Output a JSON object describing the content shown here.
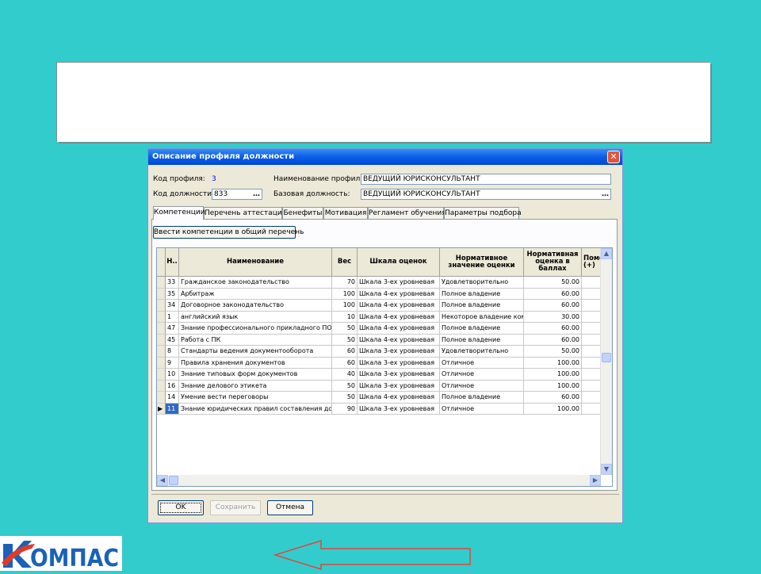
{
  "dialog": {
    "title": "Описание профиля должности",
    "close_glyph": "✕",
    "profile_code_label": "Код профиля:",
    "profile_code_value": "3",
    "profile_name_label": "Наименование профиля:",
    "profile_name_value": "ВЕДУЩИЙ ЮРИСКОНСУЛЬТАНТ",
    "position_code_label": "Код должности:",
    "position_code_value": "833",
    "base_position_label": "Базовая должность:",
    "base_position_value": "ВЕДУЩИЙ ЮРИСКОНСУЛЬТАНТ",
    "ellipsis": "…",
    "tabs": [
      {
        "label": "Компетенции",
        "active": true
      },
      {
        "label": "Перечень аттестаций",
        "active": false
      },
      {
        "label": "Бенефиты",
        "active": false
      },
      {
        "label": "Мотивация",
        "active": false
      },
      {
        "label": "Регламент обучения",
        "active": false
      },
      {
        "label": "Параметры подбора",
        "active": false
      }
    ],
    "add_competencies_button": "Ввести компетенции в общий перечень",
    "grid": {
      "columns": [
        "Н..",
        "Наименование",
        "Вес",
        "Шкала оценок",
        "Нормативное значение оценки",
        "Нормативная оценка в баллах",
        "Поме. (+)"
      ],
      "rows": [
        [
          "33",
          "Гражданское законодательство",
          "70",
          "Шкала 3-ех уровневая",
          "Удовлетворительно",
          "50.00"
        ],
        [
          "35",
          "Арбитраж",
          "100",
          "Шкала 4-ех уровневая",
          "Полное владение",
          "60.00"
        ],
        [
          "34",
          "Договорное законодательство",
          "100",
          "Шкала 4-ех уровневая",
          "Полное владение",
          "60.00"
        ],
        [
          "1",
          "английский язык",
          "10",
          "Шкала 4-ех уровневая",
          "Некоторое владение ком",
          "30.00"
        ],
        [
          "47",
          "Знание профессионального прикладного ПО",
          "50",
          "Шкала 4-ех уровневая",
          "Полное владение",
          "60.00"
        ],
        [
          "45",
          "Работа с ПК",
          "50",
          "Шкала 4-ех уровневая",
          "Полное владение",
          "60.00"
        ],
        [
          "8",
          "Стандарты ведения документооборота",
          "60",
          "Шкала 3-ех уровневая",
          "Удовлетворительно",
          "50.00"
        ],
        [
          "9",
          "Правила хранения документов",
          "60",
          "Шкала 3-ех уровневая",
          "Отличное",
          "100.00"
        ],
        [
          "10",
          "Знание типовых форм документов",
          "40",
          "Шкала 3-ех уровневая",
          "Отличное",
          "100.00"
        ],
        [
          "16",
          "Знание делового этикета",
          "50",
          "Шкала 3-ех уровневая",
          "Отличное",
          "100.00"
        ],
        [
          "14",
          "Умение вести переговоры",
          "50",
          "Шкала 4-ех уровневая",
          "Полное владение",
          "60.00"
        ],
        [
          "11",
          "Знание юридических правил составления док",
          "90",
          "Шкала 3-ех уровневая",
          "Отличное",
          "100.00"
        ]
      ],
      "selected_row": 11
    },
    "ok_button": "OK",
    "save_button": "Сохранить",
    "cancel_button": "Отмена"
  },
  "logo": {
    "text": "КОМПАС"
  },
  "colors": {
    "background": "#33cccc",
    "titlebar": "#0a5ee6",
    "selection": "#316ac5",
    "arrow": "#e0463c"
  }
}
